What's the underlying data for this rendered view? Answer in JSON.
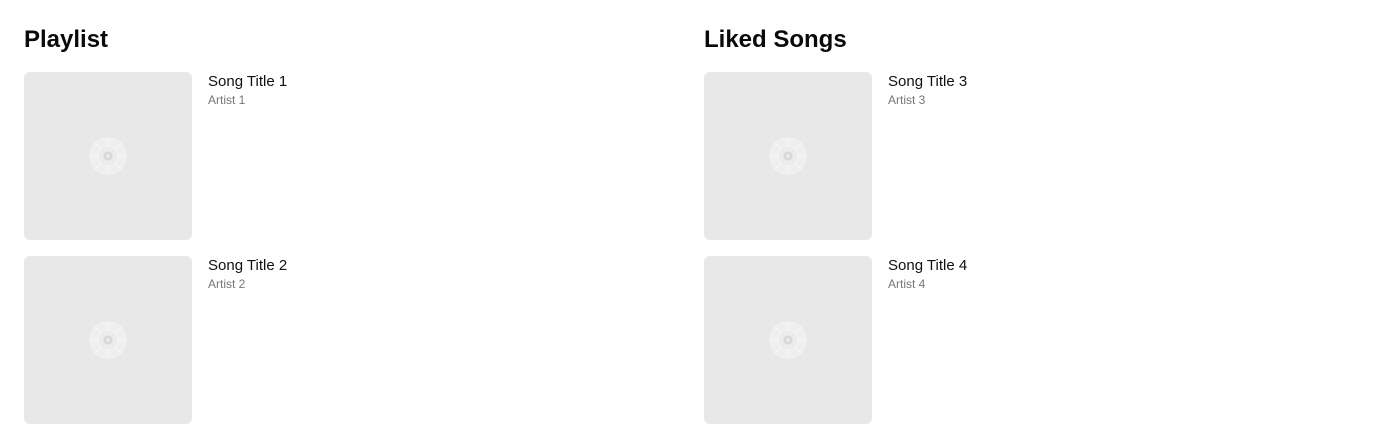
{
  "sections": [
    {
      "title": "Playlist",
      "songs": [
        {
          "title": "Song Title 1",
          "artist": "Artist 1",
          "cover_icon": "music-disc-icon"
        },
        {
          "title": "Song Title 2",
          "artist": "Artist 2",
          "cover_icon": "music-disc-icon"
        }
      ]
    },
    {
      "title": "Liked Songs",
      "songs": [
        {
          "title": "Song Title 3",
          "artist": "Artist 3",
          "cover_icon": "music-disc-icon"
        },
        {
          "title": "Song Title 4",
          "artist": "Artist 4",
          "cover_icon": "music-disc-icon"
        }
      ]
    }
  ],
  "colors": {
    "cover_background": "#e8e8e8",
    "title_text": "#111111",
    "artist_text": "#777777"
  }
}
